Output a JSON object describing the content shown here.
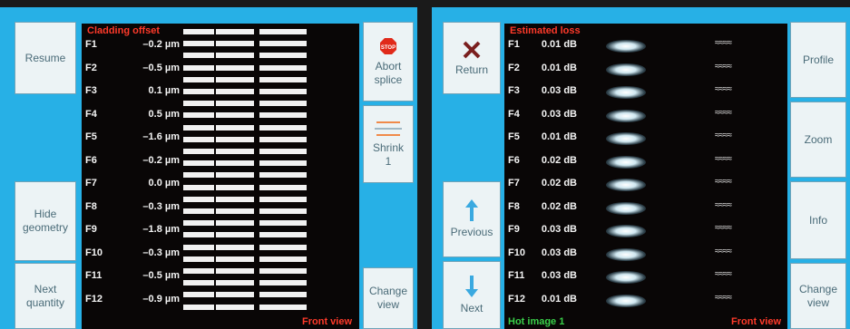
{
  "left": {
    "buttons": {
      "resume": "Resume",
      "hide_geometry_1": "Hide",
      "hide_geometry_2": "geometry",
      "next_quantity_1": "Next",
      "next_quantity_2": "quantity",
      "abort_1": "Abort",
      "abort_2": "splice",
      "shrink_1": "Shrink",
      "shrink_2": "1",
      "change_view_1": "Change",
      "change_view_2": "view"
    },
    "title": "Cladding offset",
    "rows": [
      {
        "label": "F1",
        "value": "–0.2 µm"
      },
      {
        "label": "F2",
        "value": "–0.5 µm"
      },
      {
        "label": "F3",
        "value": "0.1 µm"
      },
      {
        "label": "F4",
        "value": "0.5 µm"
      },
      {
        "label": "F5",
        "value": "–1.6 µm"
      },
      {
        "label": "F6",
        "value": "–0.2 µm"
      },
      {
        "label": "F7",
        "value": "0.0 µm"
      },
      {
        "label": "F8",
        "value": "–0.3 µm"
      },
      {
        "label": "F9",
        "value": "–1.8 µm"
      },
      {
        "label": "F10",
        "value": "–0.3 µm"
      },
      {
        "label": "F11",
        "value": "–0.5 µm"
      },
      {
        "label": "F12",
        "value": "–0.9 µm"
      }
    ],
    "footer": "Front view"
  },
  "right": {
    "buttons": {
      "return": "Return",
      "previous": "Previous",
      "next": "Next",
      "profile": "Profile",
      "zoom": "Zoom",
      "info": "Info",
      "change_view_1": "Change",
      "change_view_2": "view"
    },
    "title": "Estimated loss",
    "rows": [
      {
        "label": "F1",
        "value": "0.01 dB"
      },
      {
        "label": "F2",
        "value": "0.01 dB"
      },
      {
        "label": "F3",
        "value": "0.03 dB"
      },
      {
        "label": "F4",
        "value": "0.03 dB"
      },
      {
        "label": "F5",
        "value": "0.01 dB"
      },
      {
        "label": "F6",
        "value": "0.02 dB"
      },
      {
        "label": "F7",
        "value": "0.02 dB"
      },
      {
        "label": "F8",
        "value": "0.02 dB"
      },
      {
        "label": "F9",
        "value": "0.03 dB"
      },
      {
        "label": "F10",
        "value": "0.03 dB"
      },
      {
        "label": "F11",
        "value": "0.03 dB"
      },
      {
        "label": "F12",
        "value": "0.01 dB"
      }
    ],
    "footer_left": "Hot image 1",
    "footer_right": "Front view"
  },
  "colors": {
    "panel_blue": "#27b0e6",
    "title_red": "#ff3a2a",
    "status_green": "#3ad04a",
    "arrow_blue": "#3aa9e0",
    "x_mark": "#7a1f1f"
  }
}
